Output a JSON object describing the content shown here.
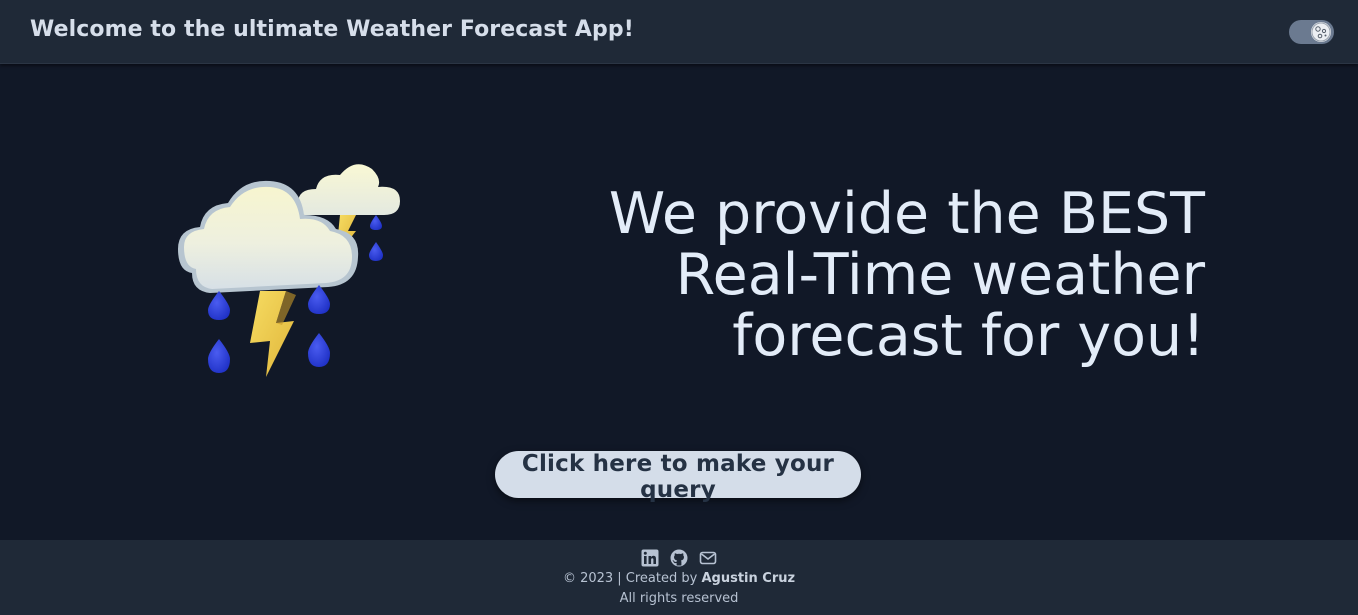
{
  "header": {
    "title": "Welcome to the ultimate Weather Forecast App!",
    "theme_toggle_icon": "moon-icon"
  },
  "hero": {
    "illustration_icon": "thunderstorm-icon",
    "heading_lines": [
      "We provide the BEST",
      "Real-Time weather",
      "forecast for you!"
    ]
  },
  "cta": {
    "label": "Click here to make your query"
  },
  "footer": {
    "icons": [
      "linkedin-icon",
      "github-icon",
      "mail-icon"
    ],
    "copyright_prefix": "© 2023 | Created by",
    "author": "Agustin Cruz",
    "rights": "All rights reserved"
  },
  "colors": {
    "background": "#111827",
    "header_bg": "#1f2937",
    "button_bg": "#d4dde9",
    "raindrop": "#2b3fd6",
    "lightning": "#f2cf4a"
  }
}
